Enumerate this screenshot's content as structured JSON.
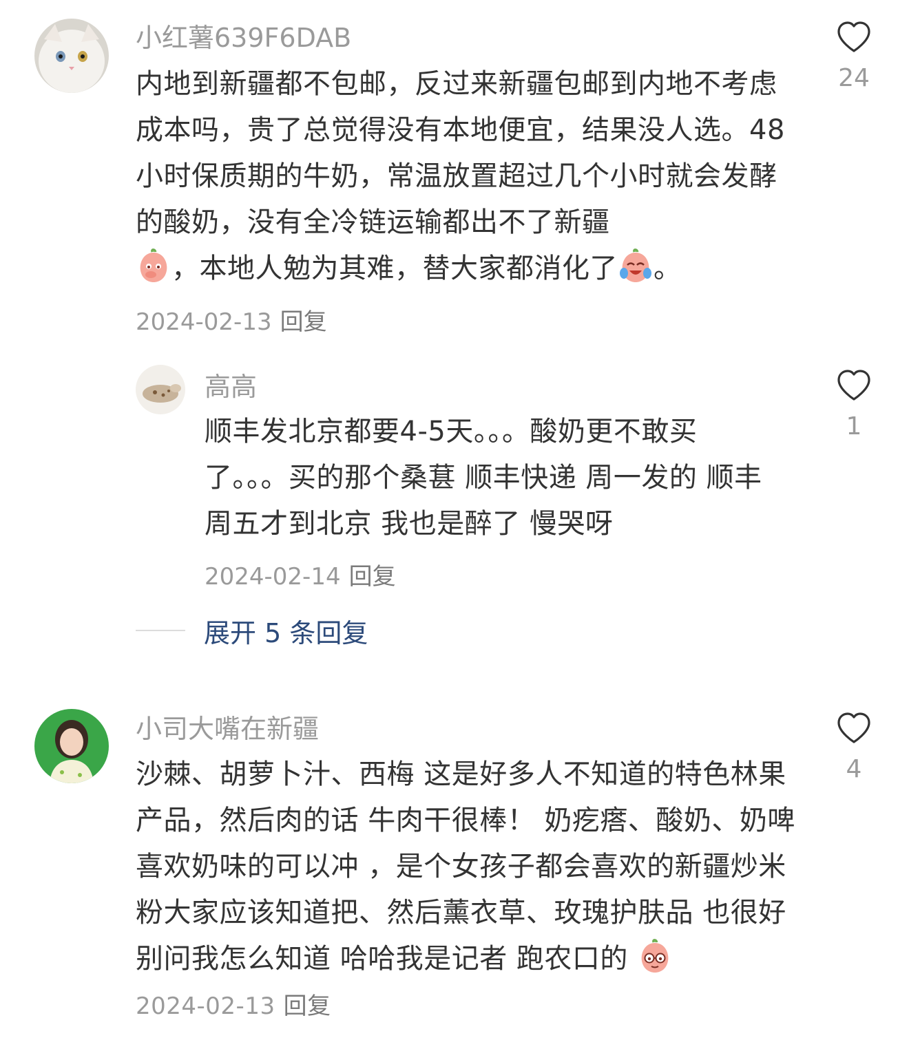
{
  "comments": [
    {
      "username": "小红薯639F6DAB",
      "text_before_emoji1": "内地到新疆都不包邮，反过来新疆包邮到内地不考虑成本吗，贵了总觉得没有本地便宜，结果没人选。48小时保质期的牛奶，常温放置超过几个小时就会发酵的酸奶，没有全冷链运输都出不了新疆",
      "emoji1": "peach-hand-over-mouth-emoji",
      "text_middle": "，本地人勉为其难，替大家都消化了",
      "emoji2": "peach-laughing-tears-emoji",
      "text_end": "。",
      "date": "2024-02-13",
      "reply_label": "回复",
      "likes": "24",
      "avatar": "white-cat-avatar"
    },
    {
      "username": "高高",
      "text": "顺丰发北京都要4-5天。。。酸奶更不敢买了。。。买的那个桑葚 顺丰快递 周一发的 顺丰周五才到北京 我也是醉了 慢哭呀",
      "date": "2024-02-14",
      "reply_label": "回复",
      "likes": "1",
      "avatar": "cat-plush-avatar"
    },
    {
      "username": "小司大嘴在新疆",
      "text": "沙棘、胡萝卜汁、西梅 这是好多人不知道的特色林果产品，然后肉的话 牛肉干很棒！ 奶疙瘩、酸奶、奶啤喜欢奶味的可以冲 ，是个女孩子都会喜欢的新疆炒米粉大家应该知道把、然后薰衣草、玫瑰护肤品 也很好 别问我怎么知道 哈哈我是记者 跑农口的",
      "emoji": "peach-glasses-emoji",
      "date": "2024-02-13",
      "reply_label": "回复",
      "likes": "4",
      "avatar": "girl-green-background-avatar"
    }
  ],
  "expand_replies": "展开 5 条回复",
  "colors": {
    "username": "#9a9a9a",
    "text": "#333333",
    "link": "#2c4a7a",
    "divider": "#dcdcdc"
  }
}
